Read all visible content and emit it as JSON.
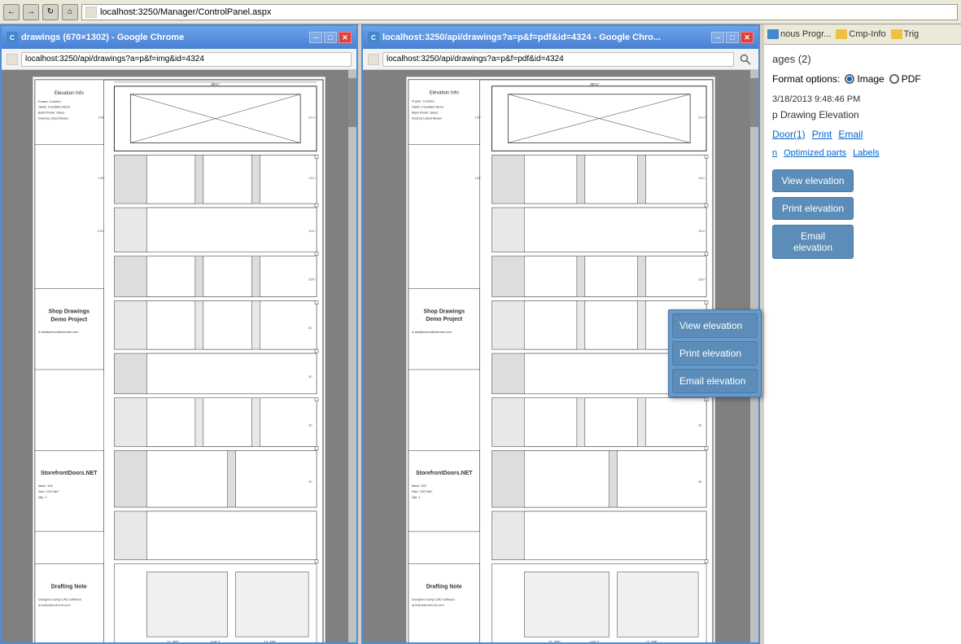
{
  "browser": {
    "address": "localhost:3250/Manager/ControlPanel.aspx",
    "favicon": "🌐"
  },
  "left_window": {
    "title": "drawings (670×1302) - Google Chrome",
    "url": "localhost:3250/api/drawings?a=p&f=img&id=4324",
    "min_btn": "─",
    "max_btn": "□",
    "close_btn": "✕"
  },
  "right_window": {
    "title": "localhost:3250/api/drawings?a=p&f=pdf&id=4324 - Google Chro...",
    "url": "localhost:3250/api/drawings?a=p&f=pdf&id=4324",
    "min_btn": "─",
    "max_btn": "□",
    "close_btn": "✕"
  },
  "bookmarks": {
    "items": [
      {
        "label": "nous Progr..."
      },
      {
        "label": "Cmp-Info"
      },
      {
        "label": "Trig"
      }
    ]
  },
  "panel": {
    "pages_label": "ages (2)",
    "format_options_label": "Format options:",
    "format_image_label": "Image",
    "format_pdf_label": "PDF",
    "timestamp": "3/18/2013 9:48:46 PM",
    "drawing_elevation_label": "p Drawing Elevation",
    "action_links": {
      "door_label": "Door(1)",
      "print_label": "Print",
      "email_label": "Email"
    },
    "sub_links": {
      "n_label": "n",
      "optimized_parts_label": "Optimized parts",
      "labels_label": "Labels"
    }
  },
  "buttons": {
    "view_elevation": "View elevation",
    "print_elevation": "Print elevation",
    "email_elevation": "Email elevation"
  },
  "popup": {
    "view_elevation": "View elevation",
    "print_elevation": "Print elevation",
    "email_elevation": "Email elevation"
  }
}
